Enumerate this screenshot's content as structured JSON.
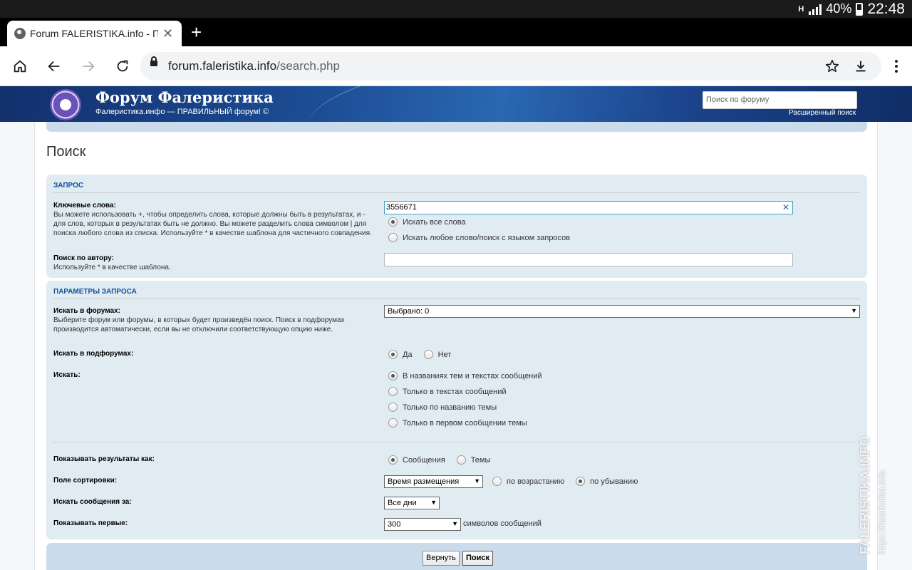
{
  "status_bar": {
    "net": "H",
    "battery": "40%",
    "time": "22:48"
  },
  "browser": {
    "tab_title": "Forum FALERISTIKA.info - П",
    "url_domain": "forum.faleristika.info",
    "url_path": "/search.php"
  },
  "header": {
    "site_title": "Форум Фалеристика",
    "site_desc": "Фалеристика.инфо — ПРАВИЛЬНЫЙ форум! ©",
    "search_placeholder": "Поиск по форуму",
    "advanced_search": "Расширенный поиск"
  },
  "page": {
    "title": "Поиск"
  },
  "query": {
    "heading": "ЗАПРОС",
    "keywords_label": "Ключевые слова:",
    "keywords_help": "Вы можете использовать +, чтобы определить слова, которые должны быть в результатах, и - для слов, которых в результатах быть не должно. Вы можете разделить слова символом | для поиска любого слова из списка. Используйте * в качестве шаблона для частичного совпадения.",
    "keywords_value": "3556671",
    "opt_all": "Искать все слова",
    "opt_any": "Искать любое слово/поиск с языком запросов",
    "author_label": "Поиск по автору:",
    "author_help": "Используйте * в качестве шаблона."
  },
  "params": {
    "heading": "ПАРАМЕТРЫ ЗАПРОСА",
    "forums_label": "Искать в форумах:",
    "forums_help": "Выберите форум или форумы, в которых будет произведён поиск. Поиск в подфорумах производится автоматически, если вы не отключили соответствующую опцию ниже.",
    "forums_selected": "Выбрано: 0",
    "subforums_label": "Искать в подфорумах:",
    "yes": "Да",
    "no": "Нет",
    "search_in_label": "Искать:",
    "search_in": [
      "В названиях тем и текстах сообщений",
      "Только в текстах сообщений",
      "Только по названию темы",
      "Только в первом сообщении темы"
    ],
    "show_as_label": "Показывать результаты как:",
    "posts": "Сообщения",
    "topics": "Темы",
    "sort_label": "Поле сортировки:",
    "sort_value": "Время размещения",
    "asc": "по возрастанию",
    "desc": "по убыванию",
    "period_label": "Искать сообщения за:",
    "period_value": "Все дни",
    "show_first_label": "Показывать первые:",
    "show_first_value": "300",
    "chars_suffix": "символов сообщений"
  },
  "buttons": {
    "reset": "Вернуть",
    "search": "Поиск"
  },
  "watermark": {
    "main": "FALERISTIKA.INFO",
    "sub": "https://faleristika.info"
  }
}
